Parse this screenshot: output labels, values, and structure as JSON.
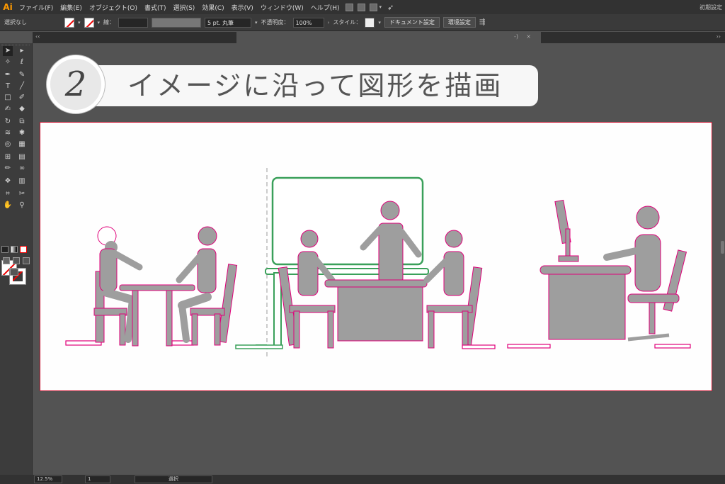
{
  "app": {
    "logo": "Ai",
    "workspace_label": "初期設定"
  },
  "menu": [
    "ファイル(F)",
    "編集(E)",
    "オブジェクト(O)",
    "書式(T)",
    "選択(S)",
    "効果(C)",
    "表示(V)",
    "ウィンドウ(W)",
    "ヘルプ(H)"
  ],
  "control_bar": {
    "selection_label": "選択なし",
    "stroke_label": "線：",
    "brush_label": "5 pt. 丸筆",
    "opacity_label": "不透明度：",
    "opacity_value": "100%",
    "style_label": "スタイル：",
    "document_setup_button": "ドキュメント設定",
    "preferences_button": "環境設定"
  },
  "tabs": {
    "collapse_glyph": "-)",
    "close_glyph": "×",
    "panel_toggle": "‹‹",
    "panel_toggle_right": "››"
  },
  "step": {
    "number": "2",
    "title": "イメージに沿って図形を描画"
  },
  "status_bar": {
    "zoom": "12.5%",
    "artboard_number": "1",
    "tool_name": "選択"
  },
  "colors": {
    "accent": "#ff9a00",
    "guide_pink": "#e0007a",
    "guide_green": "#3aa05a",
    "figure_gray": "#9e9e9e",
    "artboard_border": "#c8102e"
  },
  "icons": [
    "selection-tool-icon",
    "direct-selection-tool-icon",
    "magic-wand-icon",
    "lasso-icon",
    "pen-tool-icon",
    "curvature-tool-icon",
    "type-tool-icon",
    "line-tool-icon",
    "rectangle-tool-icon",
    "paintbrush-icon",
    "shaper-tool-icon",
    "eraser-icon",
    "rotate-tool-icon",
    "scale-tool-icon",
    "width-tool-icon",
    "puppet-warp-icon",
    "shape-builder-icon",
    "perspective-grid-icon",
    "mesh-tool-icon",
    "gradient-tool-icon",
    "eyedropper-icon",
    "blend-tool-icon",
    "symbol-sprayer-icon",
    "graph-tool-icon",
    "artboard-tool-icon",
    "slice-tool-icon",
    "hand-tool-icon",
    "zoom-tool-icon"
  ]
}
